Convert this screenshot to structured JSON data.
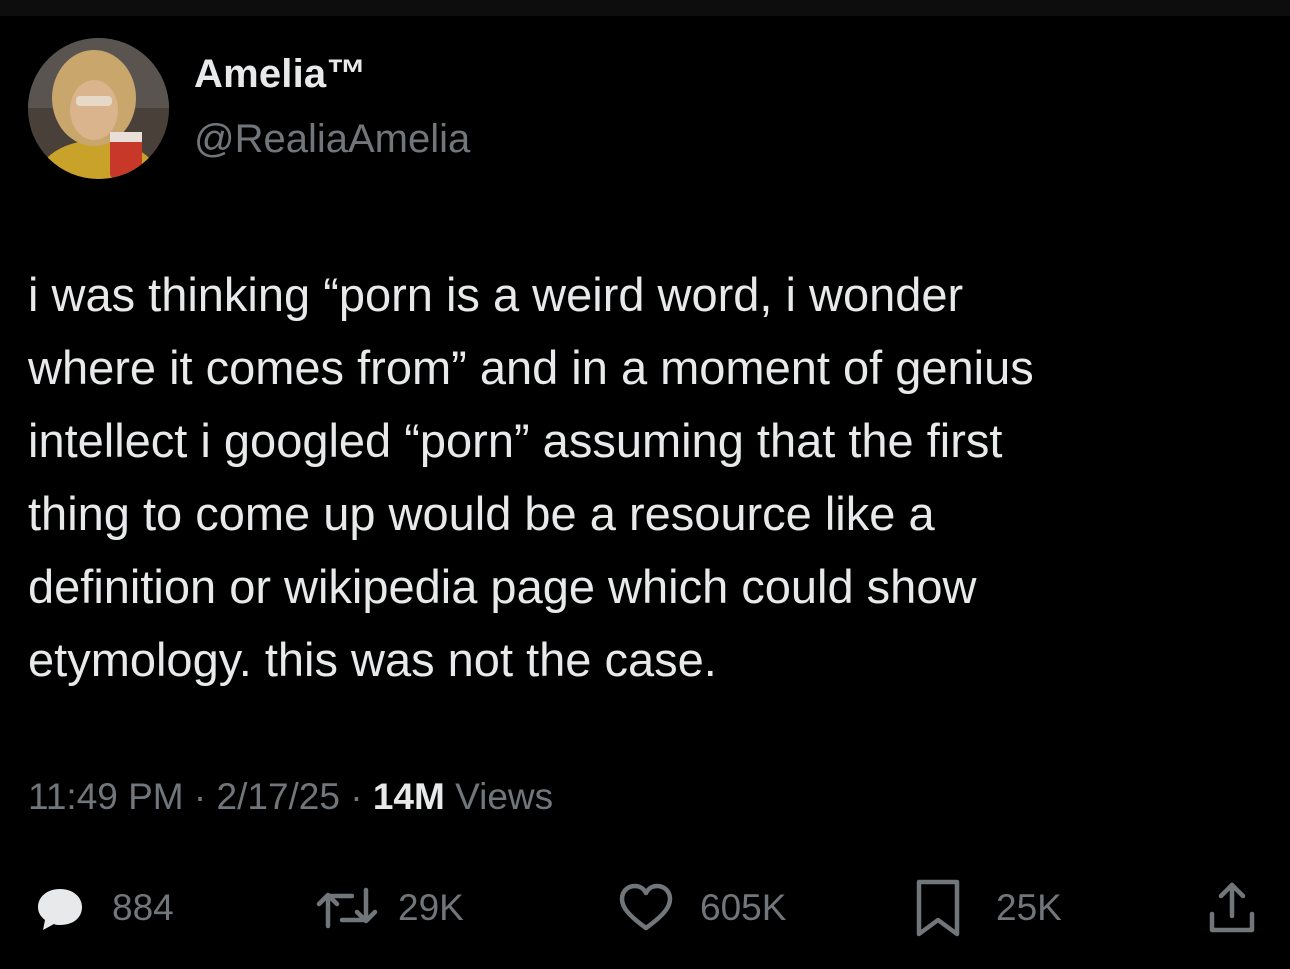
{
  "user": {
    "display_name": "Amelia™",
    "handle": "@RealiaAmelia",
    "avatar_icon": "profile-photo"
  },
  "tweet": {
    "text": "i was thinking “porn is a weird word, i wonder\nwhere it comes from” and in a moment of genius\nintellect i googled “porn” assuming that the first\nthing to come up would be a resource like a\ndefinition or wikipedia page which could show\netymology. this was not the case."
  },
  "meta": {
    "time": "11:49 PM",
    "separator": " · ",
    "date": "2/17/25",
    "views_count": "14M",
    "views_label": " Views"
  },
  "actions": {
    "replies": {
      "icon": "reply-icon",
      "count": "884"
    },
    "retweets": {
      "icon": "retweet-icon",
      "count": "29K"
    },
    "likes": {
      "icon": "heart-icon",
      "count": "605K"
    },
    "bookmarks": {
      "icon": "bookmark-icon",
      "count": "25K"
    },
    "share": {
      "icon": "share-icon"
    }
  },
  "colors": {
    "background": "#000000",
    "text_primary": "#e7e9ea",
    "text_secondary": "#71767b"
  }
}
